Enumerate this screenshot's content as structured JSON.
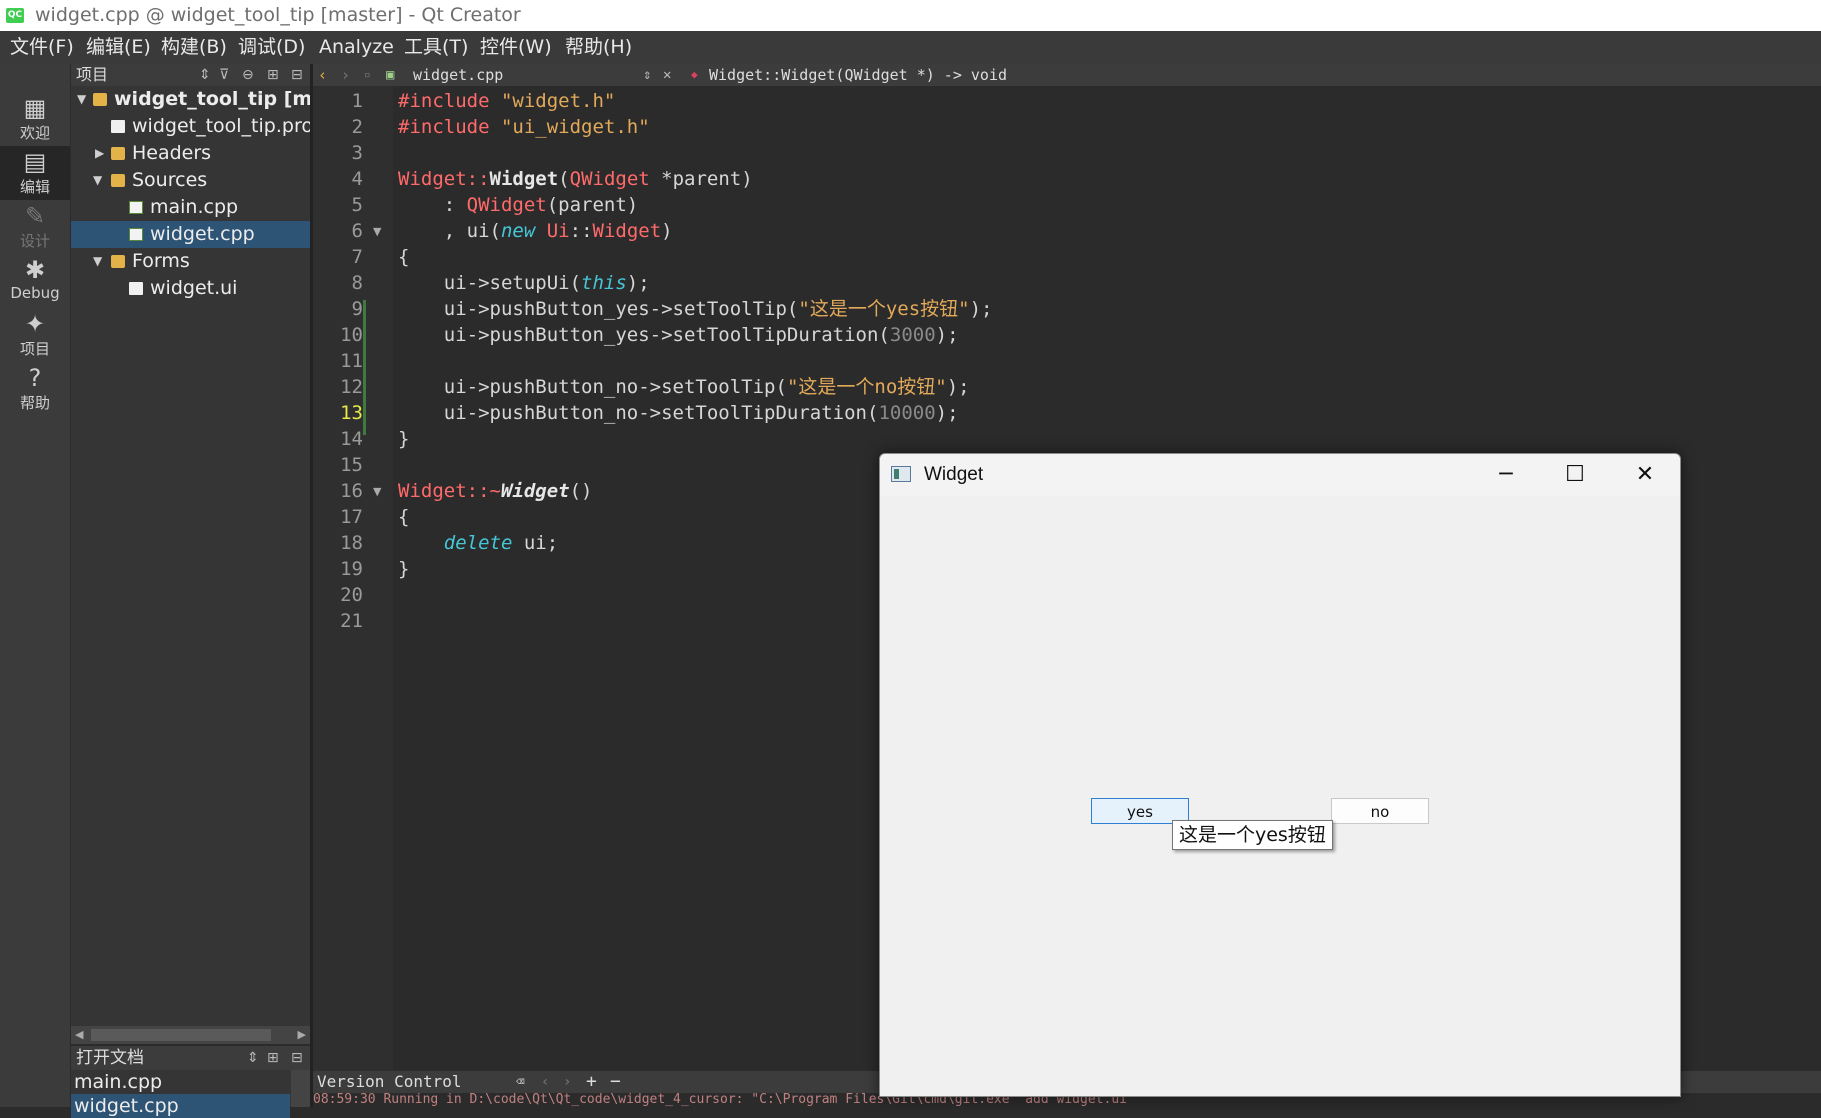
{
  "window_title": "widget.cpp @ widget_tool_tip [master] - Qt Creator",
  "app_badge": "QC",
  "menu": [
    "文件(F)",
    "编辑(E)",
    "构建(B)",
    "调试(D)",
    "Analyze",
    "工具(T)",
    "控件(W)",
    "帮助(H)"
  ],
  "modes": [
    {
      "label": "欢迎",
      "glyph": "▦"
    },
    {
      "label": "编辑",
      "glyph": "▤"
    },
    {
      "label": "设计",
      "glyph": "✎"
    },
    {
      "label": "Debug",
      "glyph": "✱"
    },
    {
      "label": "项目",
      "glyph": "✦"
    },
    {
      "label": "帮助",
      "glyph": "?"
    }
  ],
  "project_pane": {
    "title": "项目",
    "tree": [
      {
        "label": "widget_tool_tip [master]",
        "expanded": true,
        "icon": "project-icon"
      },
      {
        "label": "widget_tool_tip.pro",
        "icon": "pro-file-icon"
      },
      {
        "label": "Headers",
        "expanded": false,
        "icon": "folder-icon"
      },
      {
        "label": "Sources",
        "expanded": true,
        "icon": "folder-icon"
      },
      {
        "label": "main.cpp",
        "icon": "cpp-file-icon"
      },
      {
        "label": "widget.cpp",
        "icon": "cpp-file-icon",
        "selected": true
      },
      {
        "label": "Forms",
        "expanded": true,
        "icon": "folder-icon"
      },
      {
        "label": "widget.ui",
        "icon": "ui-file-icon"
      }
    ]
  },
  "open_docs": {
    "title": "打开文档",
    "items": [
      "main.cpp",
      "widget.cpp"
    ]
  },
  "editor": {
    "file": "widget.cpp",
    "symbol": "Widget::Widget(QWidget *) -> void",
    "current_line": 13,
    "line_numbers": [
      "1",
      "2",
      "3",
      "4",
      "5",
      "6",
      "7",
      "8",
      "9",
      "10",
      "11",
      "12",
      "13",
      "14",
      "15",
      "16",
      "17",
      "18",
      "19",
      "20",
      "21"
    ],
    "code": {
      "l1_dir": "#include",
      "l1_str": "\"widget.h\"",
      "l2_dir": "#include",
      "l2_str": "\"ui_widget.h\"",
      "l4_cls": "Widget",
      "l4_sep": "::",
      "l4_fn": "Widget",
      "l4_p1": "(",
      "l4_ty": "QWidget",
      "l4_p2": " *parent)",
      "l5_a": "    : ",
      "l5_ty": "QWidget",
      "l5_b": "(parent)",
      "l6_a": "    , ui(",
      "l6_kw": "new",
      "l6_b": " ",
      "l6_ty": "Ui",
      "l6_c": "::",
      "l6_ty2": "Widget",
      "l6_d": ")",
      "l7": "{",
      "l8_a": "    ui->setupUi(",
      "l8_kw": "this",
      "l8_b": ");",
      "l9_a": "    ui->pushButton_yes->setToolTip(",
      "l9_str": "\"这是一个yes按钮\"",
      "l9_b": ");",
      "l10_a": "    ui->pushButton_yes->setToolTipDuration(",
      "l10_num": "3000",
      "l10_b": ");",
      "l12_a": "    ui->pushButton_no->setToolTip(",
      "l12_str": "\"这是一个no按钮\"",
      "l12_b": ");",
      "l13_a": "    ui->pushButton_no->setToolTipDuration(",
      "l13_num": "10000",
      "l13_b": ");",
      "l14": "}",
      "l16_cls": "Widget",
      "l16_sep": "::~",
      "l16_fn": "Widget",
      "l16_b": "()",
      "l17": "{",
      "l18_a": "    ",
      "l18_kw": "delete",
      "l18_b": " ui;",
      "l19": "}"
    }
  },
  "bottom": {
    "panel": "Version Control",
    "log": "08:59:30 Running in D:\\code\\Qt\\Qt_code\\widget_4_cursor: \"C:\\Program Files\\Git\\cmd\\git.exe\" add widget.ui"
  },
  "widget_window": {
    "title": "Widget",
    "btn_yes": "yes",
    "btn_no": "no",
    "tooltip": "这是一个yes按钮"
  }
}
